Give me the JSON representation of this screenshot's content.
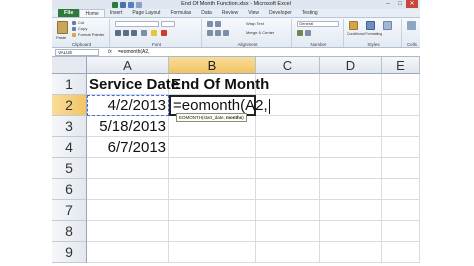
{
  "window": {
    "title": "End Of Month Function.xlsx - Microsoft Excel",
    "minimize": "–",
    "maximize": "□",
    "close": "✕"
  },
  "menu": {
    "file": "File",
    "tabs": [
      "Home",
      "Insert",
      "Page Layout",
      "Formulas",
      "Data",
      "Review",
      "View",
      "Developer",
      "Testing"
    ],
    "active_index": 0
  },
  "ribbon": {
    "clipboard": {
      "label": "Clipboard",
      "paste": "Paste",
      "cut": "Cut",
      "copy": "Copy",
      "format_painter": "Format Painter"
    },
    "font": {
      "label": "Font"
    },
    "alignment": {
      "label": "Alignment",
      "wrap_text": "Wrap Text",
      "merge": "Merge & Center"
    },
    "number": {
      "label": "Number",
      "format": "General"
    },
    "styles": {
      "label": "Styles",
      "conditional": "Conditional Formatting",
      "format_table": "Format as Table",
      "cell_styles": "Cell Styles"
    },
    "cells": {
      "label": "Cells",
      "insert": "Insert"
    }
  },
  "formula_bar": {
    "name_box": "VALUE",
    "fx": "fx",
    "content": "=eomonth(A2,"
  },
  "columns": [
    "A",
    "B",
    "C",
    "D",
    "E"
  ],
  "rows": [
    "1",
    "2",
    "3",
    "4",
    "5",
    "6",
    "7",
    "8",
    "9"
  ],
  "cells": {
    "A1": "Service Date",
    "B1": "End Of Month",
    "A2": "4/2/2013",
    "B2": "=eomonth(A2,",
    "A3": "5/18/2013",
    "A4": "6/7/2013"
  },
  "tooltip": {
    "fn": "EOMONTH(start_date, ",
    "arg": "months",
    "close": ")"
  },
  "colors": {
    "file_tab": "#2d7b3a",
    "selected_header": "#f2c463",
    "close_button": "#c9463d"
  }
}
